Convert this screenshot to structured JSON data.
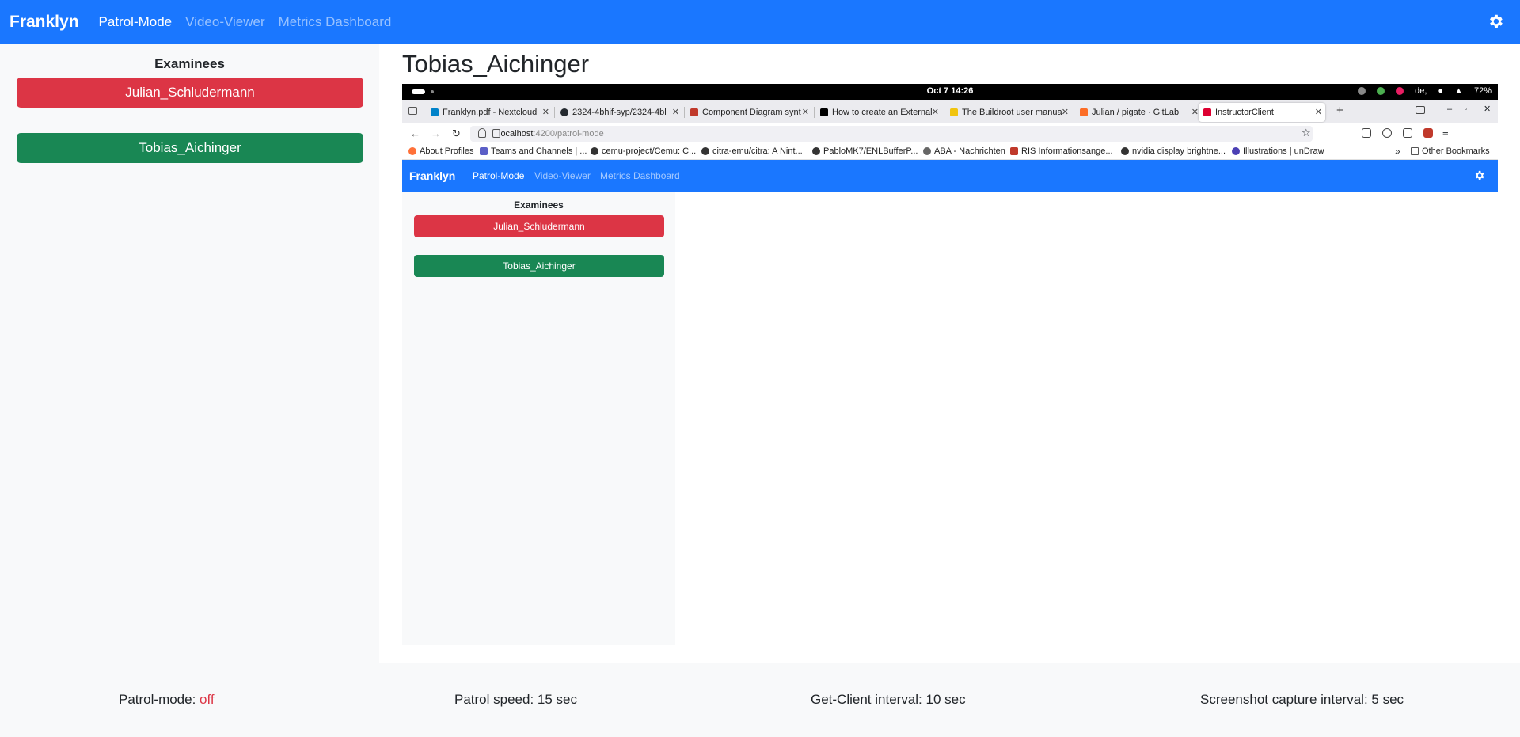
{
  "navbar": {
    "brand": "Franklyn",
    "links": [
      "Patrol-Mode",
      "Video-Viewer",
      "Metrics Dashboard"
    ],
    "active": "Patrol-Mode"
  },
  "sidebar": {
    "title": "Examinees",
    "examinees": [
      {
        "name": "Julian_Schludermann",
        "status_color": "#dc3545"
      },
      {
        "name": "Tobias_Aichinger",
        "status_color": "#198754"
      }
    ]
  },
  "main": {
    "selected_examinee": "Tobias_Aichinger"
  },
  "screenshot": {
    "system_bar": {
      "clock": "Oct 7  14:26",
      "keyboard": "de,",
      "battery": "72%"
    },
    "tabs": [
      {
        "title": "Franklyn.pdf - Nextcloud",
        "color": "#0082c9"
      },
      {
        "title": "2324-4bhif-syp/2324-4bl",
        "color": "#24292f"
      },
      {
        "title": "Component Diagram synt",
        "color": "#c0392b"
      },
      {
        "title": "How to create an External",
        "color": "#000000"
      },
      {
        "title": "The Buildroot user manua",
        "color": "#f1c40f"
      },
      {
        "title": "Julian / pigate · GitLab",
        "color": "#fc6d26"
      },
      {
        "title": "InstructorClient",
        "color": "#dd0031"
      }
    ],
    "url": {
      "host": "localhost",
      "path": ":4200/patrol-mode"
    },
    "bookmarks": [
      "About Profiles",
      "Teams and Channels | ...",
      "cemu-project/Cemu: C...",
      "citra-emu/citra: A Nint...",
      "PabloMK7/ENLBufferP...",
      "ABA - Nachrichten",
      "RIS Informationsange...",
      "nvidia display brightne...",
      "Illustrations | unDraw",
      "Other Bookmarks"
    ],
    "inner_app": {
      "brand": "Franklyn",
      "links": [
        "Patrol-Mode",
        "Video-Viewer",
        "Metrics Dashboard"
      ],
      "sidebar_title": "Examinees",
      "examinees": [
        "Julian_Schludermann",
        "Tobias_Aichinger"
      ]
    }
  },
  "footer": {
    "patrol_mode_label": "Patrol-mode: ",
    "patrol_mode_value": "off",
    "patrol_speed": "Patrol speed: 15 sec",
    "get_client_interval": "Get-Client interval: 10 sec",
    "screenshot_interval": "Screenshot capture interval: 5 sec"
  },
  "colors": {
    "primary": "#1a77ff",
    "danger": "#dc3545",
    "success": "#198754"
  }
}
